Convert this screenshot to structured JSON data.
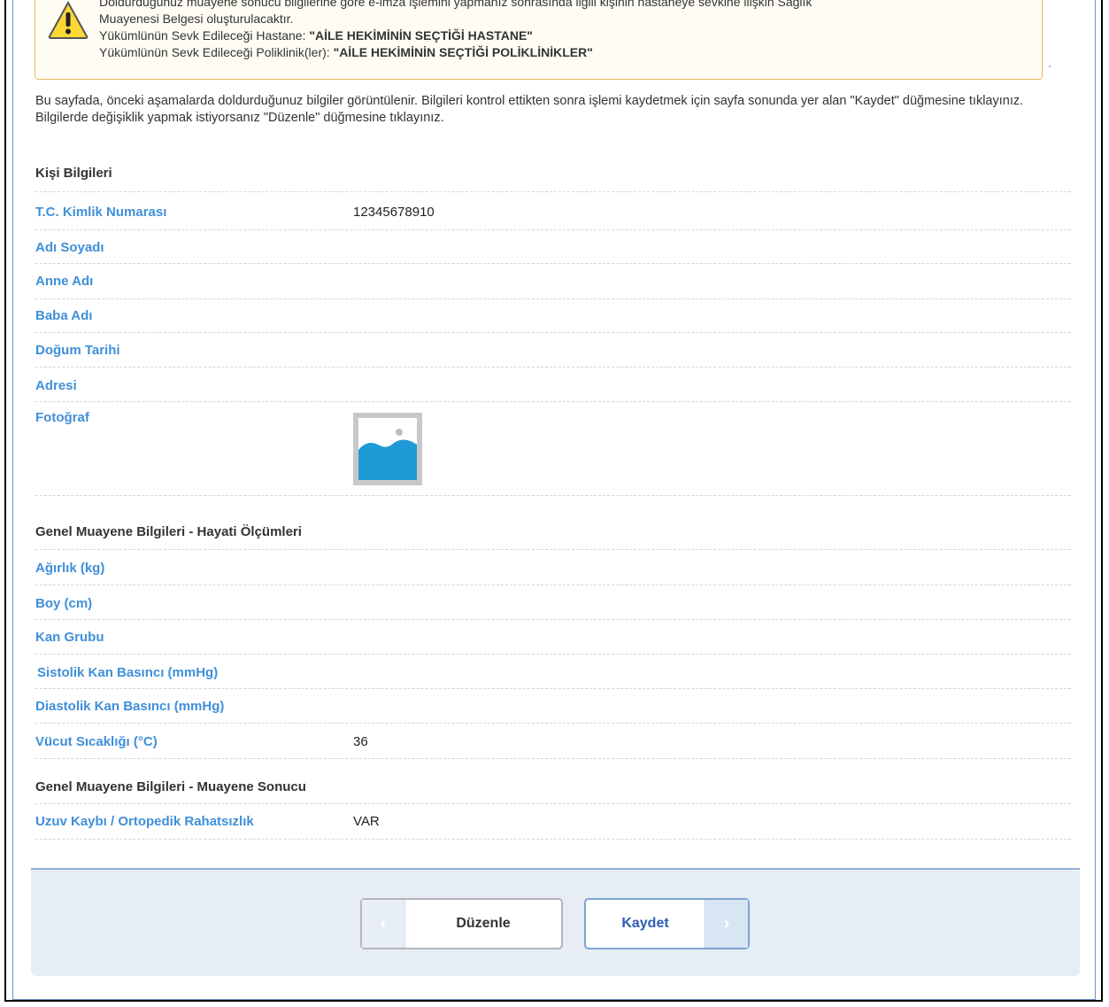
{
  "warning": {
    "line1": "Doldurduğunuz muayene sonucu bilgilerine göre e-imza işlemini yapmanız sonrasında ilgili kişinin hastaneye sevkine ilişkin Sağlık",
    "line2": "Muayenesi Belgesi oluşturulacaktır.",
    "hospital_label": "Yükümlünün Sevk Edileceği Hastane:",
    "hospital_value": "\"AİLE HEKİMİNİN SEÇTİĞİ HASTANE\"",
    "clinic_label": "Yükümlünün Sevk Edileceği Poliklinik(ler):",
    "clinic_value": "\"AİLE HEKİMİNİN SEÇTİĞİ POLİKLİNİKLER\""
  },
  "intro": "Bu sayfada, önceki aşamalarda doldurduğunuz bilgiler görüntülenir. Bilgileri kontrol ettikten sonra işlemi kaydetmek için sayfa sonunda yer alan \"Kaydet\" düğmesine tıklayınız. Bilgilerde değişiklik yapmak istiyorsanız \"Düzenle\" düğmesine tıklayınız.",
  "personal": {
    "title": "Kişi Bilgileri",
    "tc_label": "T.C. Kimlik Numarası",
    "tc_value": "12345678910",
    "name_label": "Adı Soyadı",
    "name_value": "",
    "mother_label": "Anne Adı",
    "father_label": "Baba Adı",
    "birth_label": "Doğum Tarihi",
    "address_label": "Adresi",
    "photo_label": "Fotoğraf"
  },
  "vitals": {
    "title": "Genel Muayene Bilgileri - Hayati Ölçümleri",
    "weight_label": "Ağırlık (kg)",
    "height_label": "Boy (cm)",
    "blood_label": "Kan Grubu",
    "systolic_label": "Sistolik Kan Basıncı (mmHg)",
    "diastolic_label": "Diastolik Kan Basıncı (mmHg)",
    "temp_label": "Vücut Sıcaklığı (°C)",
    "temp_value": "36"
  },
  "result": {
    "title": "Genel Muayene Bilgileri - Muayene Sonucu",
    "limb_label": "Uzuv Kaybı / Ortopedik Rahatsızlık",
    "limb_value": "VAR"
  },
  "buttons": {
    "edit_label": "Düzenle",
    "save_label": "Kaydet"
  },
  "colors": {
    "label_blue": "#3f8fd9",
    "warning_border": "#e8b86a",
    "save_text": "#2f5db8"
  }
}
